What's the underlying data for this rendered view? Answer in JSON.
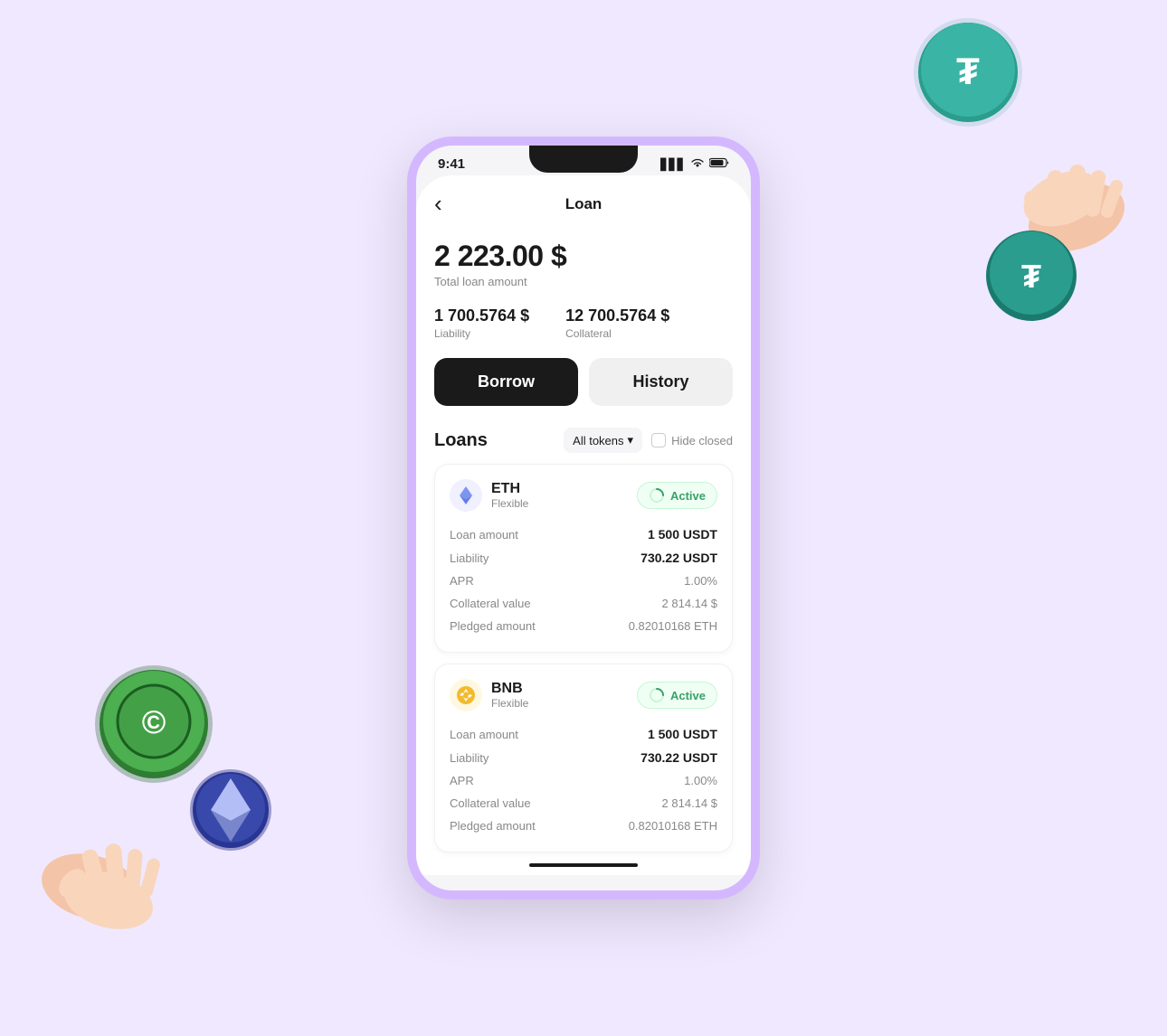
{
  "app": {
    "background_color": "#f0e8ff",
    "phone_border_color": "#d4b8ff"
  },
  "status_bar": {
    "time": "9:41",
    "signal_icon": "▋▋▋",
    "wifi_icon": "WiFi",
    "battery_icon": "▓"
  },
  "header": {
    "back_icon": "‹",
    "title": "Loan"
  },
  "summary": {
    "total_amount": "2 223.00 $",
    "total_label": "Total loan amount",
    "liability_value": "1 700.5764 $",
    "liability_label": "Liability",
    "collateral_value": "12 700.5764 $",
    "collateral_label": "Collateral"
  },
  "tabs": {
    "borrow_label": "Borrow",
    "history_label": "History"
  },
  "loans_section": {
    "title": "Loans",
    "filter_label": "All tokens",
    "filter_icon": "▾",
    "hide_closed_label": "Hide closed"
  },
  "loans": [
    {
      "id": "eth-loan",
      "coin_name": "ETH",
      "coin_type": "Flexible",
      "coin_color": "#627eea",
      "coin_symbol": "Ξ",
      "status": "Active",
      "loan_amount_label": "Loan amount",
      "loan_amount_value": "1 500 USDT",
      "liability_label": "Liability",
      "liability_value": "730.22 USDT",
      "apr_label": "APR",
      "apr_value": "1.00%",
      "collateral_value_label": "Collateral value",
      "collateral_value_value": "2 814.14 $",
      "pledged_label": "Pledged amount",
      "pledged_value": "0.82010168 ETH"
    },
    {
      "id": "bnb-loan",
      "coin_name": "BNB",
      "coin_type": "Flexible",
      "coin_color": "#f3ba2f",
      "coin_symbol": "B",
      "status": "Active",
      "loan_amount_label": "Loan amount",
      "loan_amount_value": "1 500 USDT",
      "liability_label": "Liability",
      "liability_value": "730.22 USDT",
      "apr_label": "APR",
      "apr_value": "1.00%",
      "collateral_value_label": "Collateral value",
      "collateral_value_value": "2 814.14 $",
      "pledged_label": "Pledged amount",
      "pledged_value": "0.82010168 ETH"
    }
  ]
}
